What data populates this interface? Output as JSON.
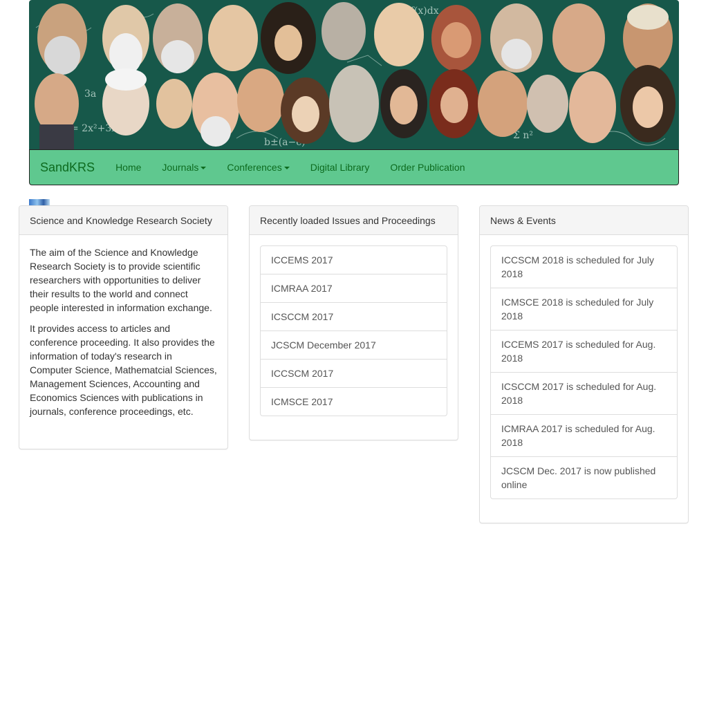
{
  "banner": {
    "alt": "Portraits of famous scientists and mathematicians"
  },
  "navbar": {
    "brand": "SandKRS",
    "items": [
      {
        "label": "Home",
        "dropdown": false
      },
      {
        "label": "Journals",
        "dropdown": true
      },
      {
        "label": "Conferences",
        "dropdown": true
      },
      {
        "label": "Digital Library",
        "dropdown": false
      },
      {
        "label": "Order Publication",
        "dropdown": false
      }
    ]
  },
  "about": {
    "heading": "Science and Knowledge Research Society",
    "paragraphs": [
      "The aim of the Science and Knowledge Research Society is to provide scientific researchers with opportunities to deliver their results to the world and connect people interested in information exchange.",
      "It provides access to articles and conference proceeding. It also provides the information of today's research in Computer Science, Mathematcial Sciences, Management Sciences, Accounting and Economics Sciences with publications in journals, conference proceedings, etc."
    ]
  },
  "recent": {
    "heading": "Recently loaded Issues and Proceedings",
    "items": [
      "ICCEMS 2017",
      "ICMRAA 2017",
      "ICSCCM 2017",
      "JCSCM December 2017",
      "ICCSCM 2017",
      "ICMSCE 2017"
    ]
  },
  "news": {
    "heading": "News & Events",
    "items": [
      "ICCSCM 2018 is scheduled for July 2018",
      "ICMSCE 2018 is scheduled for July 2018",
      "ICCEMS 2017 is scheduled for Aug. 2018",
      "ICSCCM 2017 is scheduled for Aug. 2018",
      "ICMRAA 2017 is scheduled for Aug. 2018",
      "JCSCM Dec. 2017 is now published online"
    ]
  },
  "colors": {
    "navbar_bg": "#5fc88f",
    "nav_text": "#0d6b1f",
    "banner_bg": "#17584a"
  }
}
